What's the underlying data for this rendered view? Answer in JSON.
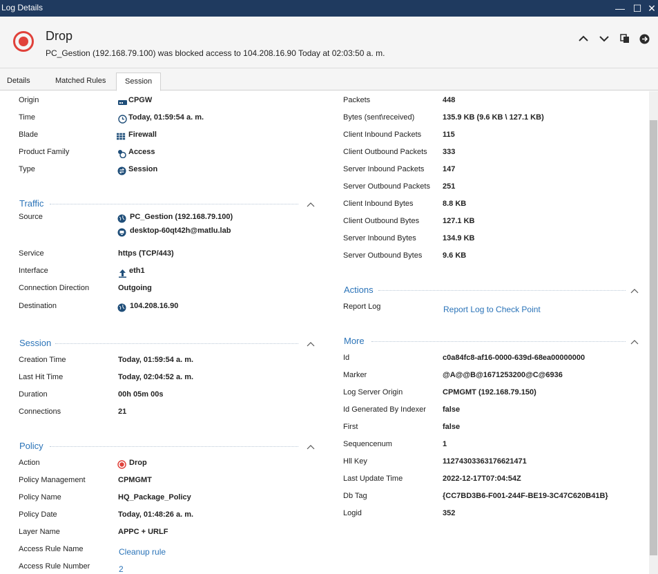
{
  "window": {
    "title": "Log Details",
    "minimize_glyph": "—",
    "maximize_glyph": "☐",
    "close_glyph": "✕"
  },
  "header": {
    "title": "Drop",
    "description": "PC_Gestion (192.168.79.100) was blocked access to 104.208.16.90 Today at  02:03:50 a. m."
  },
  "tabs": [
    {
      "label": "Details"
    },
    {
      "label": "Matched Rules"
    },
    {
      "label": "Session"
    }
  ],
  "left_top": {
    "rows": [
      {
        "label": "Origin",
        "value": "CPGW",
        "icon": "gateway-icon"
      },
      {
        "label": "Time",
        "value": "Today, 01:59:54 a. m.",
        "icon": "clock-icon"
      },
      {
        "label": "Blade",
        "value": "Firewall",
        "icon": "firewall-icon"
      },
      {
        "label": "Product Family",
        "value": "Access",
        "icon": "access-icon"
      },
      {
        "label": "Type",
        "value": "Session",
        "icon": "session-icon"
      }
    ]
  },
  "traffic": {
    "title": "Traffic",
    "source_label": "Source",
    "source_value": "PC_Gestion (192.168.79.100)",
    "source_user": "desktop-60qt42h@matlu.lab",
    "service_label": "Service",
    "service_value": "https (TCP/443)",
    "interface_label": "Interface",
    "interface_value": "eth1",
    "direction_label": "Connection Direction",
    "direction_value": "Outgoing",
    "destination_label": "Destination",
    "destination_value": "104.208.16.90"
  },
  "session": {
    "title": "Session",
    "rows": [
      {
        "label": "Creation Time",
        "value": "Today, 01:59:54 a. m."
      },
      {
        "label": "Last Hit Time",
        "value": "Today, 02:04:52 a. m."
      },
      {
        "label": "Duration",
        "value": "00h 05m 00s"
      },
      {
        "label": "Connections",
        "value": "21"
      }
    ]
  },
  "policy": {
    "title": "Policy",
    "action_label": "Action",
    "action_value": "Drop",
    "rows": [
      {
        "label": "Policy Management",
        "value": "CPMGMT"
      },
      {
        "label": "Policy Name",
        "value": "HQ_Package_Policy"
      },
      {
        "label": "Policy Date",
        "value": "Today, 01:48:26 a. m."
      },
      {
        "label": "Layer Name",
        "value": "APPC + URLF"
      }
    ],
    "rule_name_label": "Access Rule Name",
    "rule_name_value": "Cleanup rule",
    "rule_number_label": "Access Rule Number",
    "rule_number_value": "2"
  },
  "stats": {
    "rows": [
      {
        "label": "Packets",
        "value": "448"
      },
      {
        "label": "Bytes (sent\\received)",
        "value": "135.9 KB (9.6 KB \\ 127.1 KB)"
      },
      {
        "label": "Client Inbound Packets",
        "value": "115"
      },
      {
        "label": "Client Outbound Packets",
        "value": "333"
      },
      {
        "label": "Server Inbound Packets",
        "value": "147"
      },
      {
        "label": "Server Outbound Packets",
        "value": "251"
      },
      {
        "label": "Client Inbound Bytes",
        "value": "8.8 KB"
      },
      {
        "label": "Client Outbound Bytes",
        "value": "127.1 KB"
      },
      {
        "label": "Server Inbound Bytes",
        "value": "134.9 KB"
      },
      {
        "label": "Server Outbound Bytes",
        "value": "9.6 KB"
      }
    ]
  },
  "actions": {
    "title": "Actions",
    "report_label": "Report Log",
    "report_link": "Report Log to Check Point"
  },
  "more": {
    "title": "More",
    "rows": [
      {
        "label": "Id",
        "value": "c0a84fc8-af16-0000-639d-68ea00000000"
      },
      {
        "label": "Marker",
        "value": "@A@@B@1671253200@C@6936"
      },
      {
        "label": "Log Server Origin",
        "value": "CPMGMT (192.168.79.150)"
      },
      {
        "label": "Id Generated By Indexer",
        "value": "false"
      },
      {
        "label": "First",
        "value": "false"
      },
      {
        "label": "Sequencenum",
        "value": "1"
      },
      {
        "label": "Hll Key",
        "value": "11274303363176621471"
      },
      {
        "label": "Last Update Time",
        "value": "2022-12-17T07:04:54Z"
      },
      {
        "label": "Db Tag",
        "value": "{CC7BD3B6-F001-244F-BE19-3C47C620B41B}"
      },
      {
        "label": "Logid",
        "value": "352"
      }
    ]
  },
  "colors": {
    "accent": "#2a73b8",
    "drop_red": "#e0413a",
    "titlebar": "#1f3a5f"
  }
}
